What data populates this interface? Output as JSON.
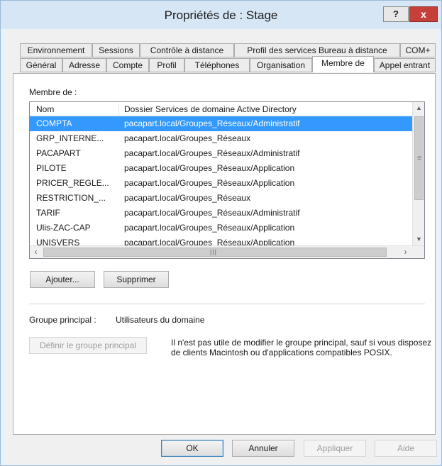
{
  "window": {
    "title": "Propriétés de : Stage",
    "help_label": "?",
    "close_label": "x"
  },
  "tabs": {
    "row1": [
      "Environnement",
      "Sessions",
      "Contrôle à distance",
      "Profil des services Bureau à distance",
      "COM+"
    ],
    "row2": [
      "Général",
      "Adresse",
      "Compte",
      "Profil",
      "Téléphones",
      "Organisation",
      "Membre de",
      "Appel entrant"
    ],
    "active": "Membre de"
  },
  "member_of": {
    "label": "Membre de :",
    "columns": [
      "Nom",
      "Dossier Services de domaine Active Directory"
    ],
    "rows": [
      {
        "name": "COMPTA",
        "folder": "pacapart.local/Groupes_Réseaux/Administratif",
        "selected": true
      },
      {
        "name": "GRP_INTERNE...",
        "folder": "pacapart.local/Groupes_Réseaux",
        "selected": false
      },
      {
        "name": "PACAPART",
        "folder": "pacapart.local/Groupes_Réseaux/Administratif",
        "selected": false
      },
      {
        "name": "PILOTE",
        "folder": "pacapart.local/Groupes_Réseaux/Application",
        "selected": false
      },
      {
        "name": "PRICER_REGLE...",
        "folder": "pacapart.local/Groupes_Réseaux/Application",
        "selected": false
      },
      {
        "name": "RESTRICTION_...",
        "folder": "pacapart.local/Groupes_Réseaux",
        "selected": false
      },
      {
        "name": "TARIF",
        "folder": "pacapart.local/Groupes_Réseaux/Administratif",
        "selected": false
      },
      {
        "name": "Ulis-ZAC-CAP",
        "folder": "pacapart.local/Groupes_Réseaux/Application",
        "selected": false
      },
      {
        "name": "UNISVERS",
        "folder": "pacapart.local/Groupes_Réseaux/Application",
        "selected": false
      }
    ],
    "add_label": "Ajouter...",
    "remove_label": "Supprimer"
  },
  "primary_group": {
    "label": "Groupe principal :",
    "value": "Utilisateurs du domaine",
    "set_label": "Définir le groupe principal",
    "info": "Il n'est pas utile de modifier le groupe principal, sauf si vous disposez de clients Macintosh ou d'applications compatibles POSIX."
  },
  "footer": {
    "ok_label": "OK",
    "cancel_label": "Annuler",
    "apply_label": "Appliquer",
    "help_label": "Aide"
  },
  "icons": {
    "scroll_up": "chevron-up-icon",
    "scroll_down": "chevron-down-icon",
    "scroll_left": "chevron-left-icon",
    "scroll_right": "chevron-right-icon"
  }
}
